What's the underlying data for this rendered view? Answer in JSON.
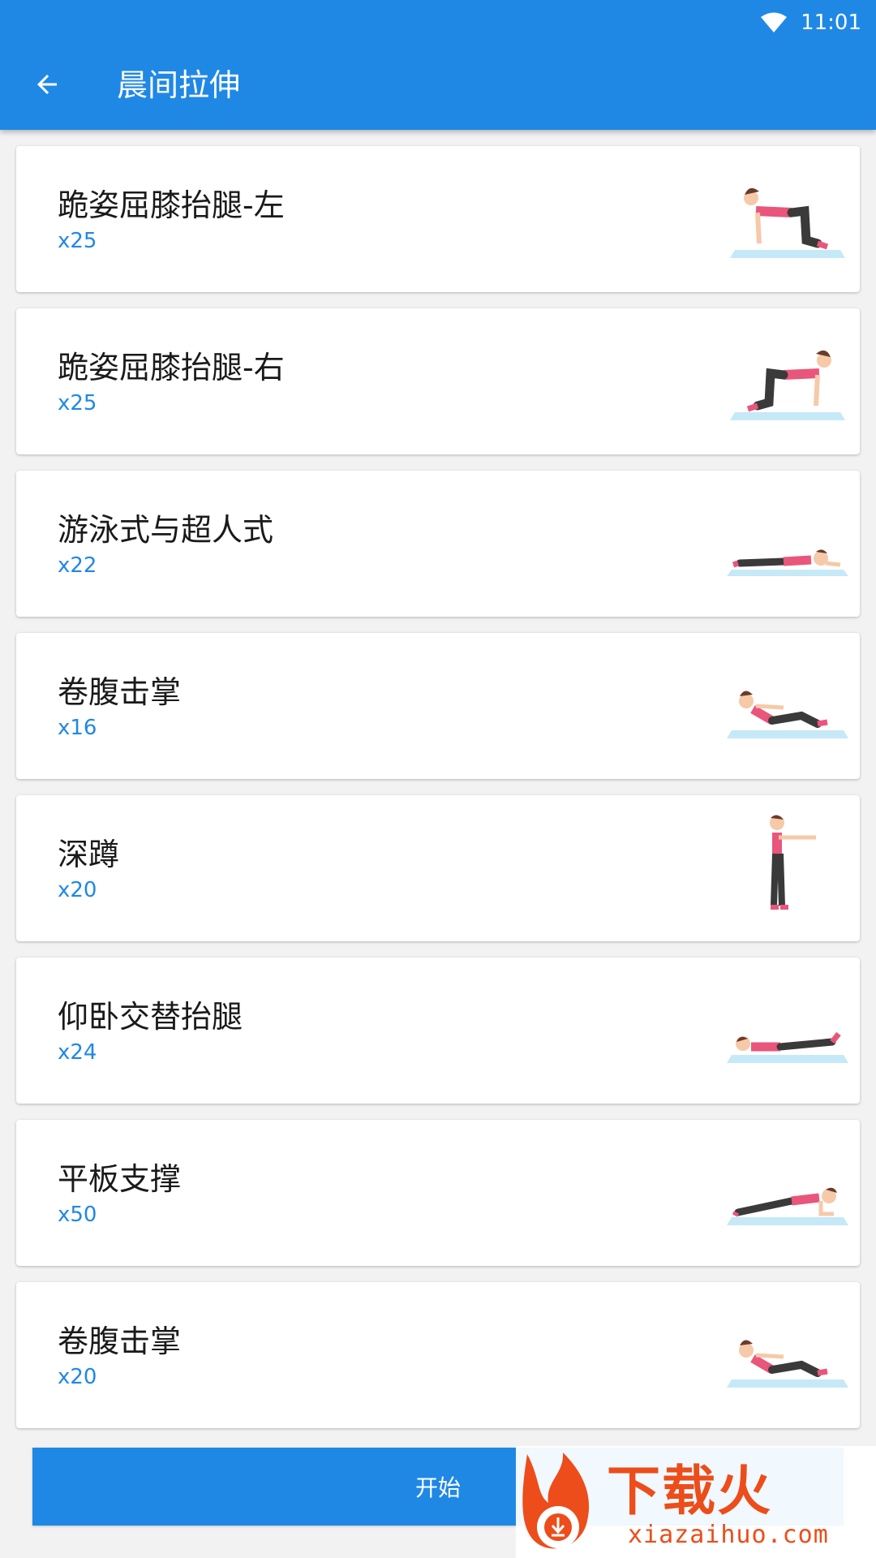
{
  "status_bar": {
    "time": "11:01",
    "wifi_icon": "wifi-icon"
  },
  "appbar": {
    "back_icon": "arrow-back-icon",
    "title": "晨间拉伸"
  },
  "exercises": [
    {
      "name": "跪姿屈膝抬腿-左",
      "count": "x25",
      "pose": "kneel-left"
    },
    {
      "name": "跪姿屈膝抬腿-右",
      "count": "x25",
      "pose": "kneel-right"
    },
    {
      "name": "游泳式与超人式",
      "count": "x22",
      "pose": "prone"
    },
    {
      "name": "卷腹击掌",
      "count": "x16",
      "pose": "crunch"
    },
    {
      "name": "深蹲",
      "count": "x20",
      "pose": "stand"
    },
    {
      "name": "仰卧交替抬腿",
      "count": "x24",
      "pose": "supine"
    },
    {
      "name": "平板支撑",
      "count": "x50",
      "pose": "plank"
    },
    {
      "name": "卷腹击掌",
      "count": "x20",
      "pose": "crunch"
    }
  ],
  "start_button": {
    "label": "开始"
  },
  "watermark": {
    "text": "下载火",
    "url": "xiazaihuo.com"
  },
  "colors": {
    "primary": "#1f88e5",
    "card": "#ffffff",
    "background": "#f2f2f2",
    "figure_pink": "#e9567b",
    "figure_dark": "#3a3a3a",
    "mat": "#c6e9f7",
    "watermark": "#ec4d1a"
  }
}
